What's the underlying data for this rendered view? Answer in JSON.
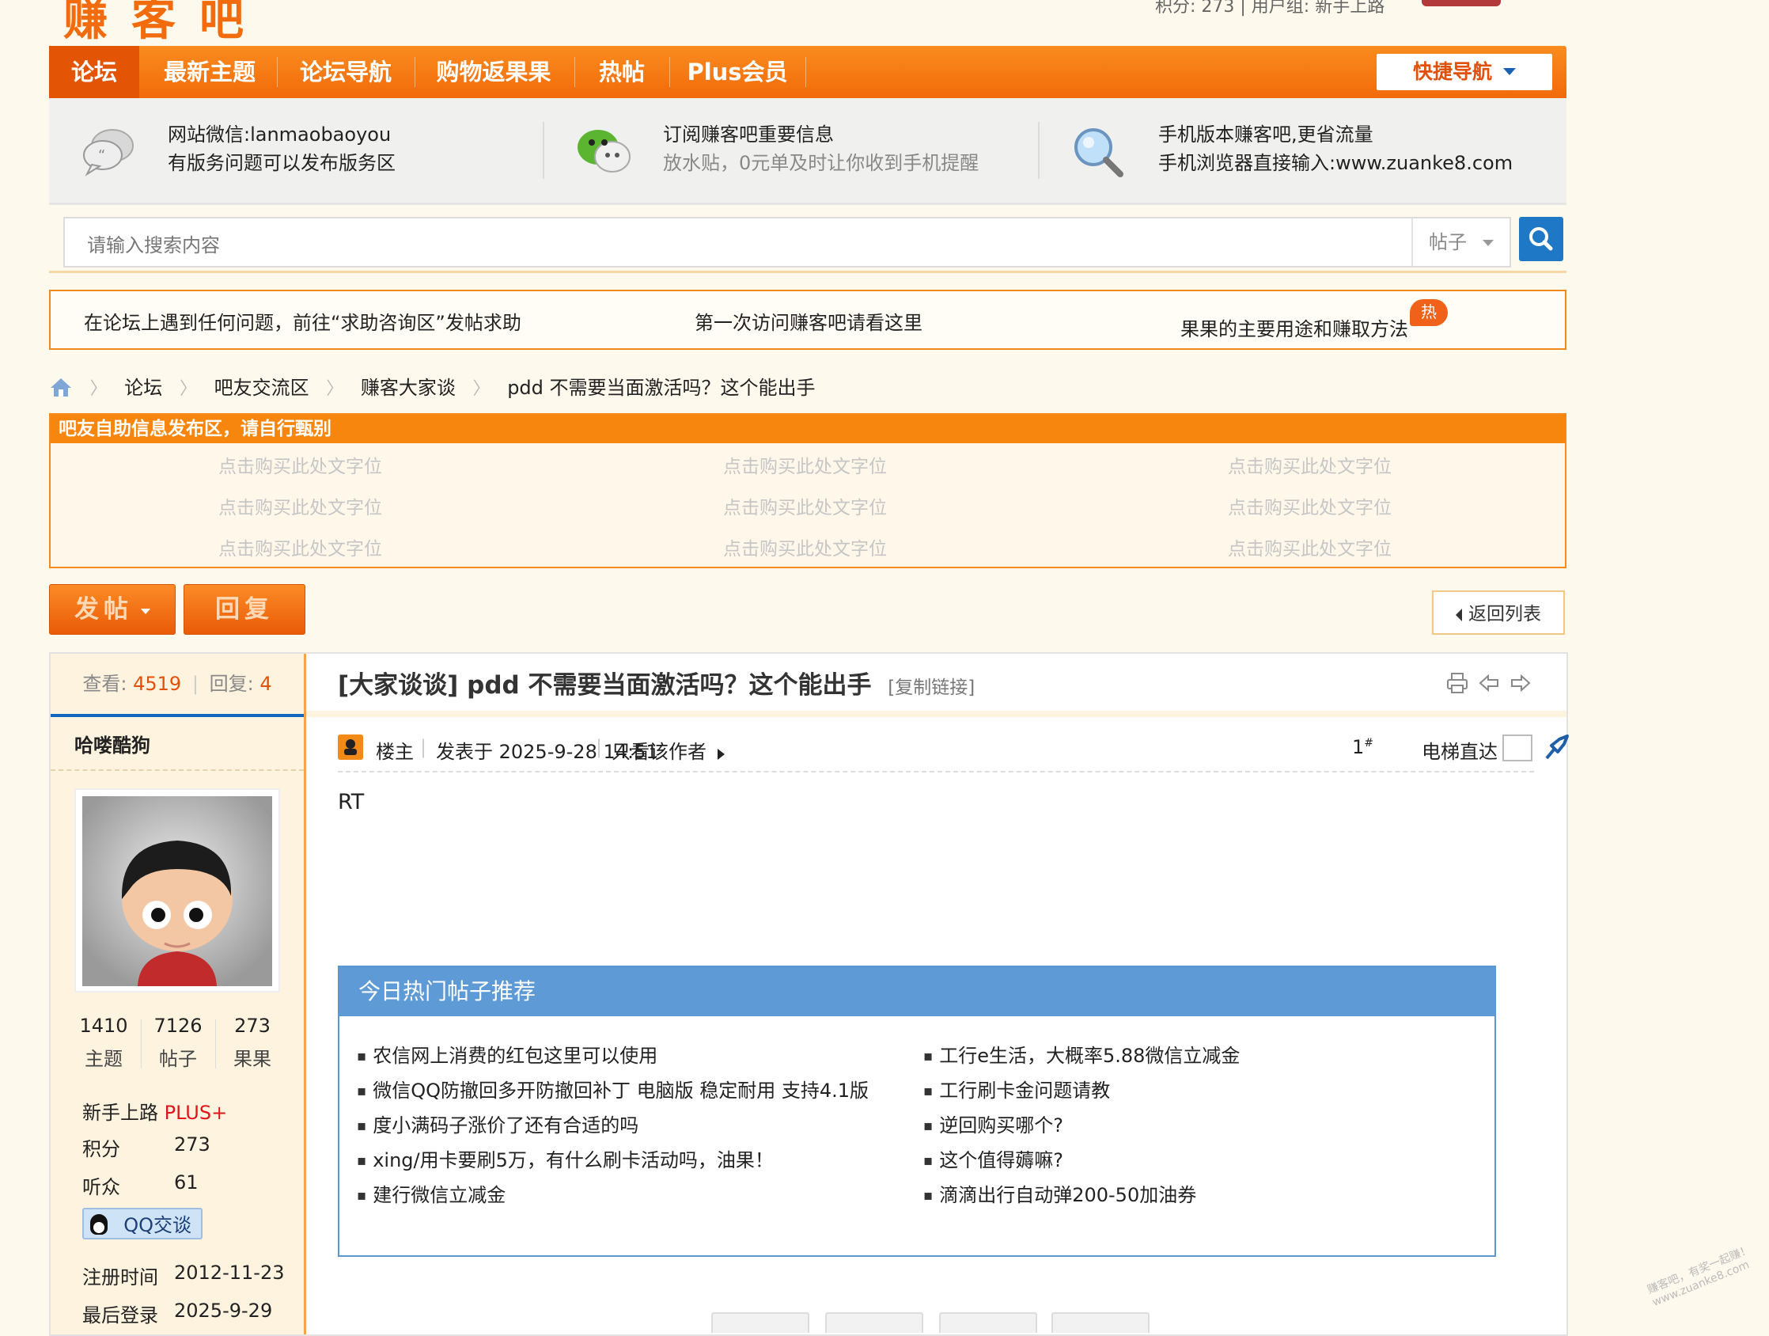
{
  "header": {
    "logo_text": "赚客吧",
    "topright_text": "积分: 273 | 用户组: 新手上路"
  },
  "nav": {
    "items": [
      "论坛",
      "最新主题",
      "论坛导航",
      "购物返果果",
      "热帖",
      "Plus会员"
    ],
    "quick_nav": "快捷导航"
  },
  "info": {
    "items": [
      {
        "line1": "网站微信:lanmaobaoyou",
        "line2": "有版务问题可以发布版务区"
      },
      {
        "line1": "订阅赚客吧重要信息",
        "line2": "放水贴，0元单及时让你收到手机提醒"
      },
      {
        "line1": "手机版本赚客吧,更省流量",
        "line2": "手机浏览器直接输入:www.zuanke8.com"
      }
    ]
  },
  "search": {
    "placeholder": "请输入搜索内容",
    "type": "帖子"
  },
  "notice": {
    "items": [
      "在论坛上遇到任何问题，前往“求助咨询区”发帖求助",
      "第一次访问赚客吧请看这里",
      "果果的主要用途和赚取方法"
    ],
    "hot_badge": "热"
  },
  "breadcrumb": [
    "论坛",
    "吧友交流区",
    "赚客大家谈",
    "pdd 不需要当面激活吗？这个能出手"
  ],
  "adbox": {
    "title": "吧友自助信息发布区，请自行甄别",
    "slot_text": "点击购买此处文字位"
  },
  "actions": {
    "post": "发帖",
    "reply": "回复",
    "back_list": "返回列表"
  },
  "post": {
    "views_label": "查看:",
    "views": "4519",
    "replies_label": "回复:",
    "replies": "4",
    "title": "[大家谈谈] pdd 不需要当面激活吗？这个能出手",
    "copy_link": "[复制链接]",
    "author_role": "楼主",
    "posted_at": "发表于 2025-9-28 14:51",
    "only_author": "只看该作者",
    "floor": "1",
    "floor_mark": "#",
    "elevator": "电梯直达",
    "content": "RT"
  },
  "user": {
    "name": "哈喽酷狗",
    "stats": [
      {
        "value": "1410",
        "label": "主题"
      },
      {
        "value": "7126",
        "label": "帖子"
      },
      {
        "value": "273",
        "label": "果果"
      }
    ],
    "group": "新手上路",
    "plus": "PLUS+",
    "score_label": "积分",
    "score": "273",
    "fans_label": "听众",
    "fans": "61",
    "qq_label": "QQ交谈",
    "reg_label": "注册时间",
    "reg_date": "2012-11-23",
    "last_label": "最后登录",
    "last_date": "2025-9-29"
  },
  "hot": {
    "title": "今日热门帖子推荐",
    "left": [
      "农信网上消费的红包这里可以使用",
      "微信QQ防撤回多开防撤回补丁 电脑版 稳定耐用 支持4.1版",
      "度小满码子涨价了还有合适的吗",
      "xing/用卡要刷5万，有什么刷卡活动吗，油果！",
      "建行微信立减金"
    ],
    "right": [
      "工行e生活，大概率5.88微信立减金",
      "工行刷卡金问题请教",
      "逆回购买哪个?",
      "这个值得薅嘛?",
      "滴滴出行自动弹200-50加油券"
    ]
  },
  "watermark": "赚客吧，有奖一起赚！ www.zuanke8.com",
  "colors": {
    "accent_orange": "#f26a0a",
    "link_blue": "#1f78c6",
    "plus_red": "#e0141a"
  }
}
